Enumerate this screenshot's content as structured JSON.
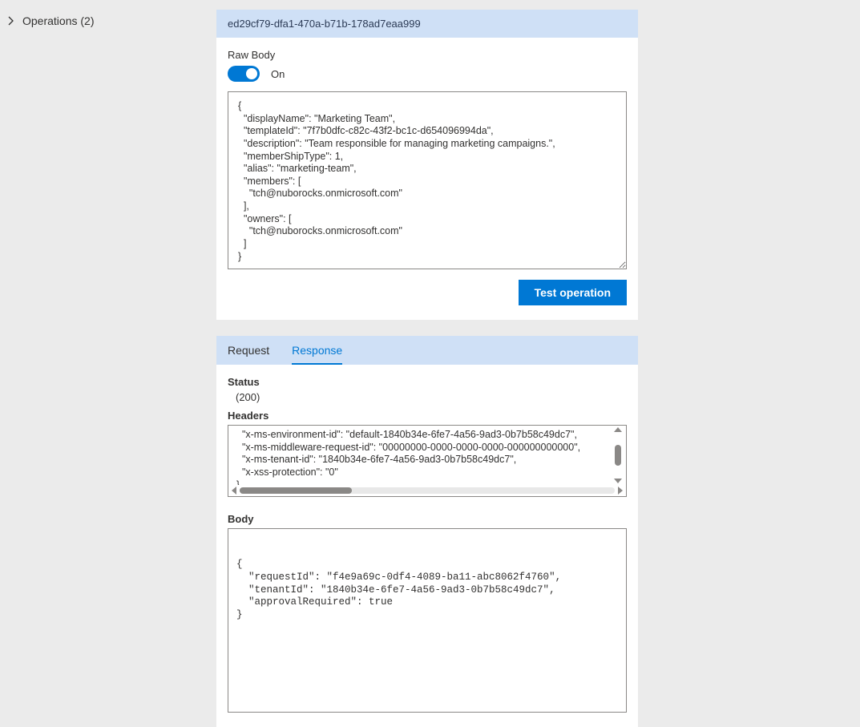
{
  "sidebar": {
    "operations_label": "Operations (2)"
  },
  "card1": {
    "header_id": "ed29cf79-dfa1-470a-b71b-178ad7eaa999",
    "raw_body_label": "Raw Body",
    "toggle_state": "On",
    "body_text": "{\n  \"displayName\": \"Marketing Team\",\n  \"templateId\": \"7f7b0dfc-c82c-43f2-bc1c-d654096994da\",\n  \"description\": \"Team responsible for managing marketing campaigns.\",\n  \"memberShipType\": 1,\n  \"alias\": \"marketing-team\",\n  \"members\": [\n    \"tch@nuborocks.onmicrosoft.com\"\n  ],\n  \"owners\": [\n    \"tch@nuborocks.onmicrosoft.com\"\n  ]\n}",
    "test_button": "Test operation"
  },
  "card2": {
    "tabs": {
      "request": "Request",
      "response": "Response"
    },
    "status_label": "Status",
    "status_value": "(200)",
    "headers_label": "Headers",
    "headers_text": "  \"x-ms-environment-id\": \"default-1840b34e-6fe7-4a56-9ad3-0b7b58c49dc7\",\n  \"x-ms-middleware-request-id\": \"00000000-0000-0000-0000-000000000000\",\n  \"x-ms-tenant-id\": \"1840b34e-6fe7-4a56-9ad3-0b7b58c49dc7\",\n  \"x-xss-protection\": \"0\"\n}",
    "body_label": "Body",
    "body_text": "{\n  \"requestId\": \"f4e9a69c-0df4-4089-ba11-abc8062f4760\",\n  \"tenantId\": \"1840b34e-6fe7-4a56-9ad3-0b7b58c49dc7\",\n  \"approvalRequired\": true\n}"
  }
}
